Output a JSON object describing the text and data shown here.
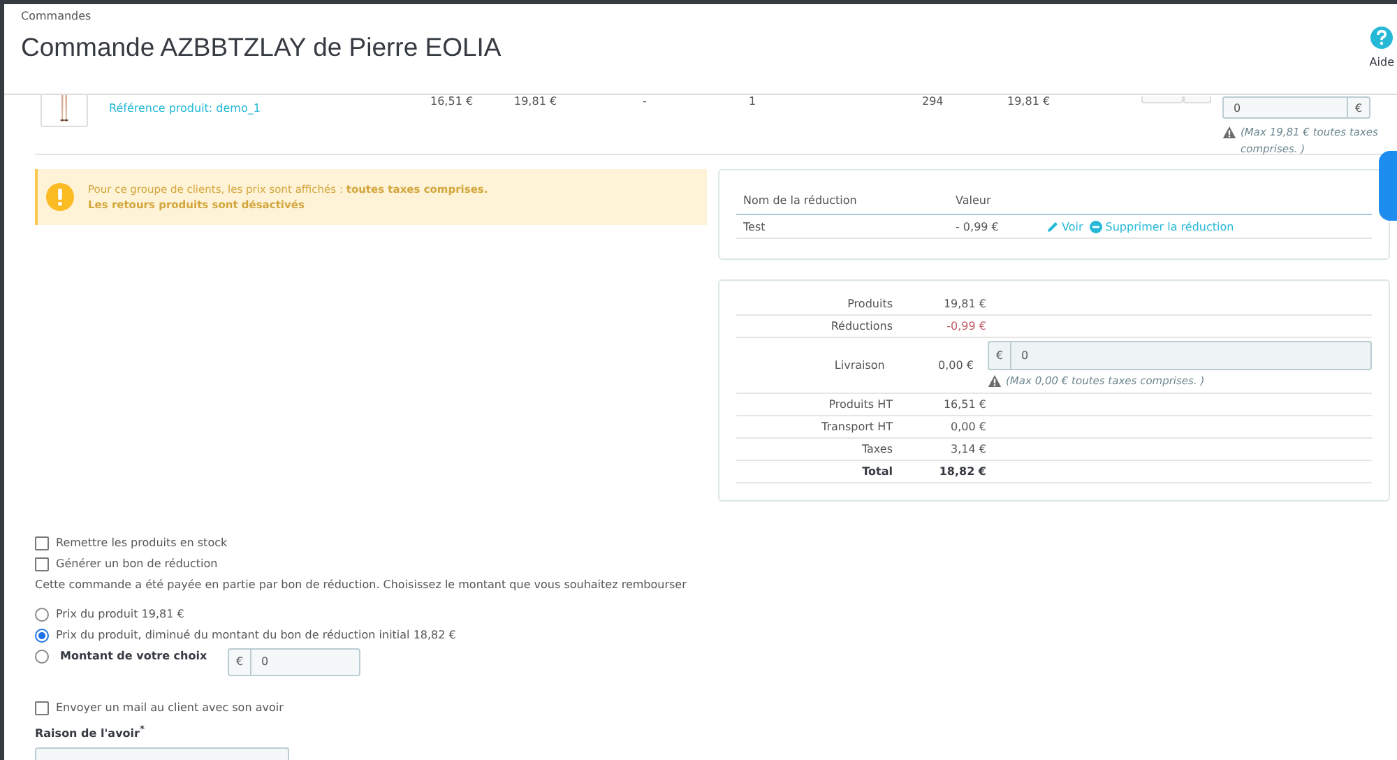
{
  "header": {
    "breadcrumb": "Commandes",
    "title": "Commande AZBBTZLAY de Pierre EOLIA",
    "help_label": "Aide"
  },
  "product_row": {
    "reference": "Référence produit: demo_1",
    "cells": [
      "16,51 €",
      "19,81 €",
      "-",
      "1",
      "294",
      "19,81 €"
    ],
    "refund": {
      "value": "0",
      "currency": "€"
    },
    "max_note": "(Max 19,81 € toutes taxes comprises. )"
  },
  "alert": {
    "line1": "Pour ce groupe de clients, les prix sont affichés : **toutes taxes comprises.**",
    "line2": "Les retours produits sont désactivés"
  },
  "discounts": {
    "columns": [
      "Nom de la réduction",
      "Valeur"
    ],
    "rows": [
      {
        "name": "Test",
        "value": "- 0,99 €",
        "actions": [
          {
            "kind": "edit",
            "label": "Voir"
          },
          {
            "kind": "remove",
            "label": "Supprimer la réduction"
          }
        ]
      }
    ]
  },
  "totals": [
    {
      "kind": "plain",
      "label": "Produits",
      "value": "19,81 €"
    },
    {
      "kind": "negative",
      "label": "Réductions",
      "value": "-0,99 €"
    },
    {
      "kind": "input",
      "label": "Livraison",
      "value": "0,00 €",
      "currency": "€",
      "field_value": "0",
      "note": "(Max 0,00 € toutes taxes comprises. )"
    },
    {
      "kind": "plain",
      "label": "Produits HT",
      "value": "16,51 €"
    },
    {
      "kind": "plain",
      "label": "Transport HT",
      "value": "0,00 €"
    },
    {
      "kind": "plain",
      "label": "Taxes",
      "value": "3,14 €"
    },
    {
      "kind": "total",
      "label": "Total",
      "value": "18,82 €"
    }
  ],
  "options": [
    {
      "label": "Remettre les produits en stock",
      "checked": false
    },
    {
      "label": "Générer un bon de réduction",
      "checked": false
    }
  ],
  "refund_note": "Cette commande a été payée en partie par bon de réduction. Choisissez le montant que vous souhaitez rembourser",
  "refund_choices": [
    {
      "kind": "text",
      "label": "Prix du produit 19,81 €",
      "selected": false
    },
    {
      "kind": "text",
      "label": "Prix du produit, diminué du montant du bon de réduction initial 18,82 €",
      "selected": true
    },
    {
      "kind": "amount",
      "label": "Montant de votre choix",
      "selected": false,
      "currency": "€",
      "value": "0"
    }
  ],
  "email_option": {
    "label": "Envoyer un mail au client avec son avoir",
    "checked": false
  },
  "reason": {
    "label": "Raison de l'avoir$^{*}$"
  }
}
